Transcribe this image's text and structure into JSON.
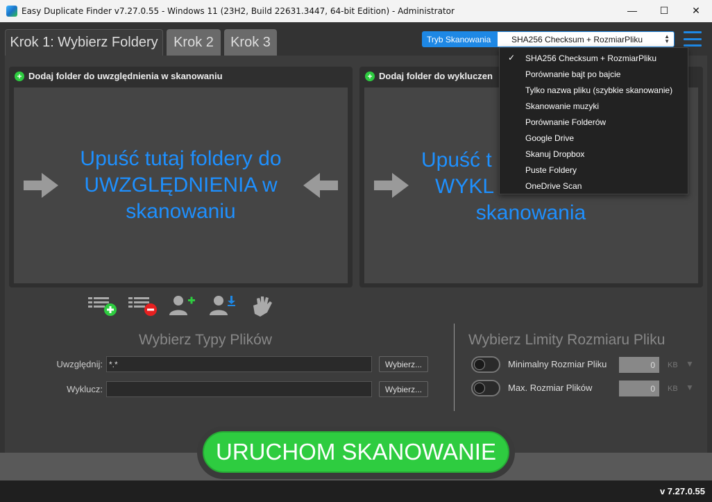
{
  "window": {
    "title": "Easy Duplicate Finder v7.27.0.55 - Windows 11 (23H2, Build 22631.3447, 64-bit Edition) - Administrator",
    "minimize": "—",
    "maximize": "☐",
    "close": "✕"
  },
  "tabs": [
    {
      "label": "Krok 1: Wybierz Foldery"
    },
    {
      "label": "Krok 2"
    },
    {
      "label": "Krok 3"
    }
  ],
  "scan_mode": {
    "label": "Tryb Skanowania",
    "selected": "SHA256 Checksum + RozmiarPliku",
    "options": [
      "SHA256 Checksum + RozmiarPliku",
      "Porównanie bajt po bajcie",
      "Tylko nazwa pliku (szybkie skanowanie)",
      "Skanowanie muzyki",
      "Porównanie Folderów",
      "Google Drive",
      "Skanuj Dropbox",
      "Puste Foldery",
      "OneDrive Scan"
    ]
  },
  "include_panel": {
    "header": "Dodaj folder do uwzględnienia w skanowaniu",
    "drop_text": "Upuść tutaj foldery do UWZGLĘDNIENIA w skanowaniu"
  },
  "exclude_panel": {
    "header": "Dodaj folder do wykluczen",
    "drop_text": "Upuść t... WYKL... skanowania",
    "line1": "Upuść t",
    "line2": "WYKL",
    "line3": "skanowania"
  },
  "file_types": {
    "title": "Wybierz Typy Plików",
    "include_label": "Uwzględnij:",
    "include_value": "*.*",
    "exclude_label": "Wyklucz:",
    "exclude_value": "",
    "browse_label": "Wybierz..."
  },
  "size_limits": {
    "title": "Wybierz Limity Rozmiaru Pliku",
    "min_label": "Minimalny Rozmiar Pliku",
    "min_value": "0",
    "max_label": "Max. Rozmiar Plików",
    "max_value": "0",
    "unit": "KB"
  },
  "start_button": "URUCHOM SKANOWANIE",
  "version": "v 7.27.0.55",
  "colors": {
    "accent_blue": "#1e88e5",
    "drop_text_blue": "#1e90ff",
    "start_green": "#2ecc40"
  }
}
